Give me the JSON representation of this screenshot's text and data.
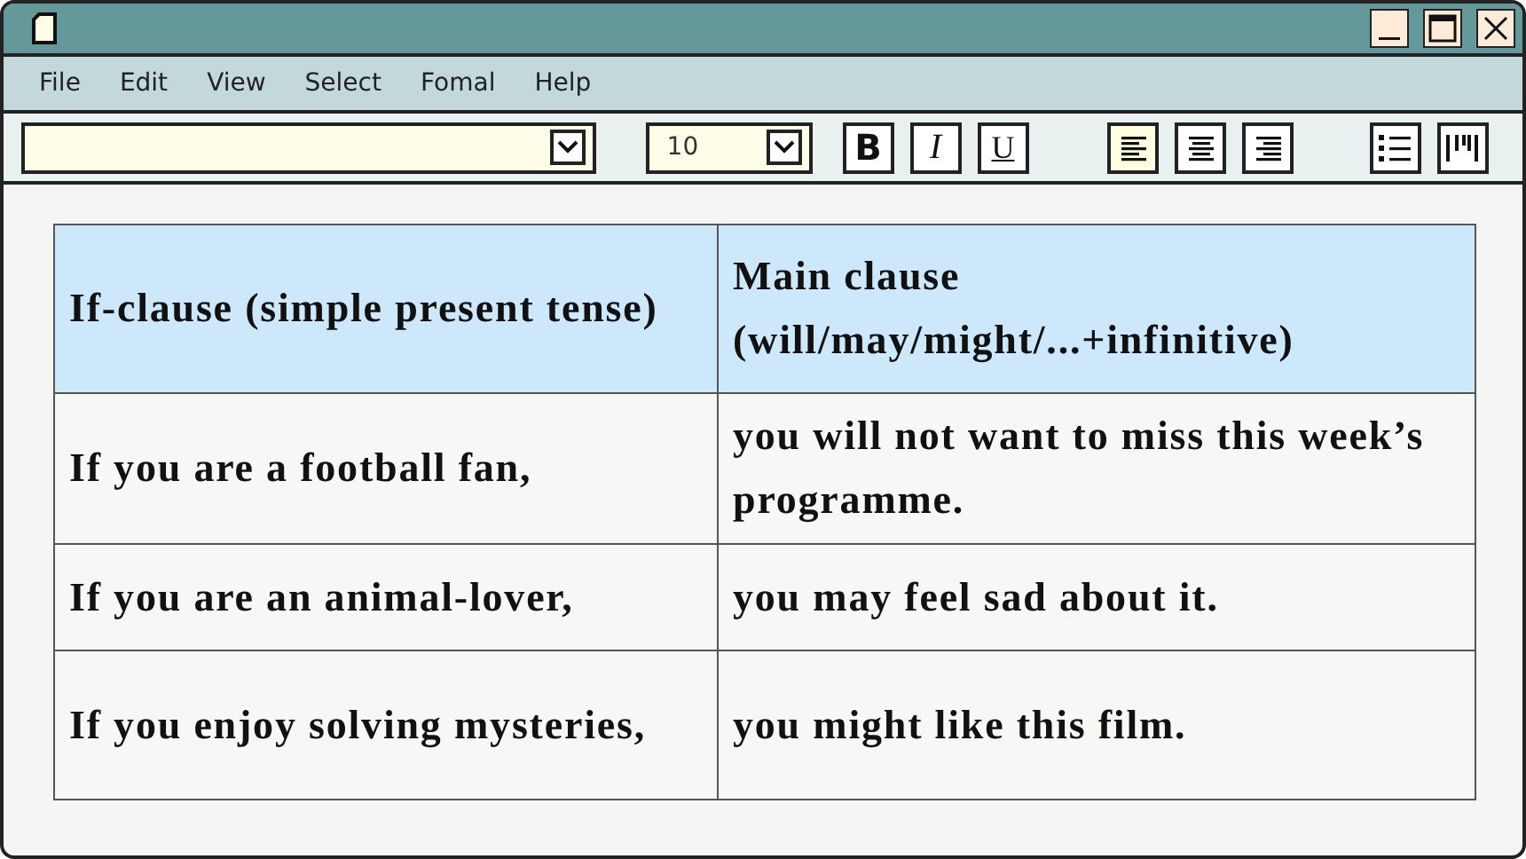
{
  "menu": [
    "File",
    "Edit",
    "View",
    "Select",
    "Fomal",
    "Help"
  ],
  "toolbar": {
    "size_field": {
      "value": "10"
    },
    "format_buttons": [
      {
        "label": "B",
        "kind": "bold"
      },
      {
        "label": "I",
        "kind": "italic"
      },
      {
        "label": "U",
        "kind": "underline"
      }
    ],
    "align_buttons": [
      {
        "kind": "left",
        "selected": true
      },
      {
        "kind": "center",
        "selected": false
      },
      {
        "kind": "right",
        "selected": false
      }
    ],
    "list_buttons": [
      {
        "kind": "bullets"
      },
      {
        "kind": "columns"
      }
    ]
  },
  "table": {
    "columns": [
      "If-clause (simple present tense)",
      "Main clause (will/may/might/...+infinitive)"
    ],
    "rows": [
      [
        "If you are a football fan,",
        "you will not want to miss this week’s programme."
      ],
      [
        "If you are an animal-lover,",
        "you may feel sad about it."
      ],
      [
        "If you enjoy solving mysteries,",
        "you might like this film."
      ]
    ]
  }
}
